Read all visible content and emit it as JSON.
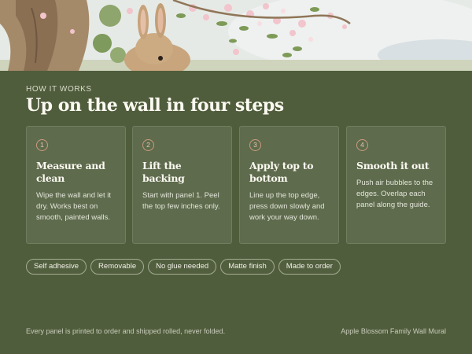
{
  "hero": {
    "image": "watercolor-rabbit-apple-blossom-illustration"
  },
  "section": {
    "eyebrow": "HOW IT WORKS",
    "title": "Up on the wall in four steps"
  },
  "steps": [
    {
      "number": "1",
      "title": "Measure and clean",
      "description": "Wipe the wall and let it dry. Works best on smooth, painted walls."
    },
    {
      "number": "2",
      "title": "Lift the backing",
      "description": "Start with panel 1. Peel the top few inches only."
    },
    {
      "number": "3",
      "title": "Apply top to bottom",
      "description": "Line up the top edge, press down slowly and work your way down."
    },
    {
      "number": "4",
      "title": "Smooth it out",
      "description": "Push air bubbles to the edges. Overlap each panel along the guide."
    }
  ],
  "tags": [
    "Self adhesive",
    "Removable",
    "No glue needed",
    "Matte finish",
    "Made to order"
  ],
  "footer": {
    "note": "Every panel is printed to order and shipped rolled, never folded.",
    "product": "Apple Blossom Family Wall Mural"
  },
  "colors": {
    "background": "#505d3c",
    "card": "#5e6b4d",
    "accent": "#cc9a7e"
  }
}
